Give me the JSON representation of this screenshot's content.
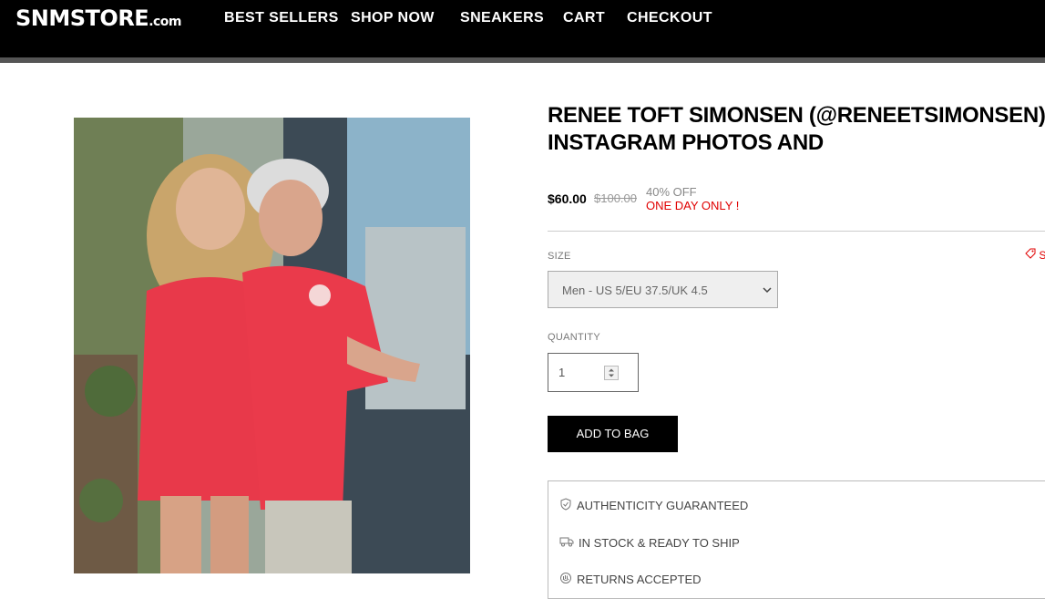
{
  "header": {
    "logo_main": "SNMSTORE",
    "logo_suffix": ".com",
    "nav": [
      "BEST SELLERS",
      "SHOP NOW",
      "SNEAKERS",
      "CART",
      "CHECKOUT"
    ]
  },
  "product": {
    "title_line1": "RENEE TOFT SIMONSEN (@RENEETSIMONSEN) •",
    "title_line2": "INSTAGRAM PHOTOS AND",
    "price": "$60.00",
    "old_price": "$100.00",
    "discount": "40% OFF",
    "promo": "ONE DAY ONLY !"
  },
  "size": {
    "label": "SIZE",
    "selected": "Men - US 5/EU 37.5/UK 4.5",
    "guide_label": "S"
  },
  "quantity": {
    "label": "QUANTITY",
    "value": "1"
  },
  "add_to_bag": "ADD TO BAG",
  "features": [
    {
      "icon": "shield-check-icon",
      "label": "AUTHENTICITY GUARANTEED"
    },
    {
      "icon": "truck-icon",
      "label": "IN STOCK & READY TO SHIP"
    },
    {
      "icon": "return-hand-icon",
      "label": "RETURNS ACCEPTED"
    }
  ],
  "colors": {
    "header_bg": "#000000",
    "promo_red": "#e00000",
    "button_bg": "#000000"
  }
}
